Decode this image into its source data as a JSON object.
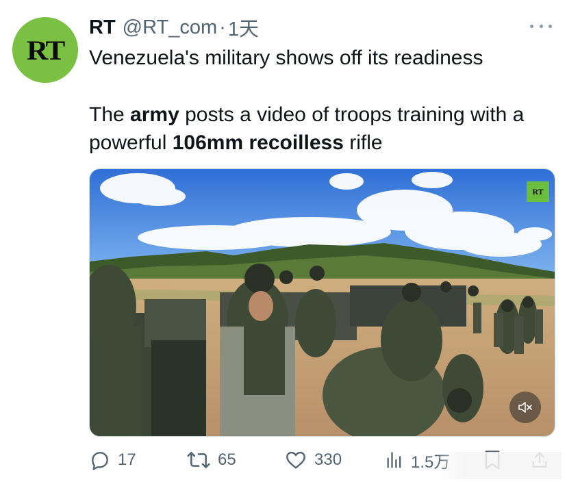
{
  "author": {
    "avatar_text": "RT",
    "name": "RT",
    "handle": "@RT_com",
    "separator": "·",
    "time": "1天"
  },
  "tweet": {
    "line1": "Venezuela's military shows off its readiness",
    "p2_a": "The ",
    "p2_b": "army",
    "p2_c": " posts a video of troops training with a powerful ",
    "p2_d": "106mm recoilless",
    "p2_e": " rifle"
  },
  "media": {
    "badge": "RT",
    "mute_icon": "speaker-muted-icon"
  },
  "actions": {
    "replies": "17",
    "retweets": "65",
    "likes": "330",
    "views": "1.5万"
  },
  "colors": {
    "brand_green": "#7ac143",
    "secondary_text": "#536471",
    "primary_text": "#0f1419"
  }
}
